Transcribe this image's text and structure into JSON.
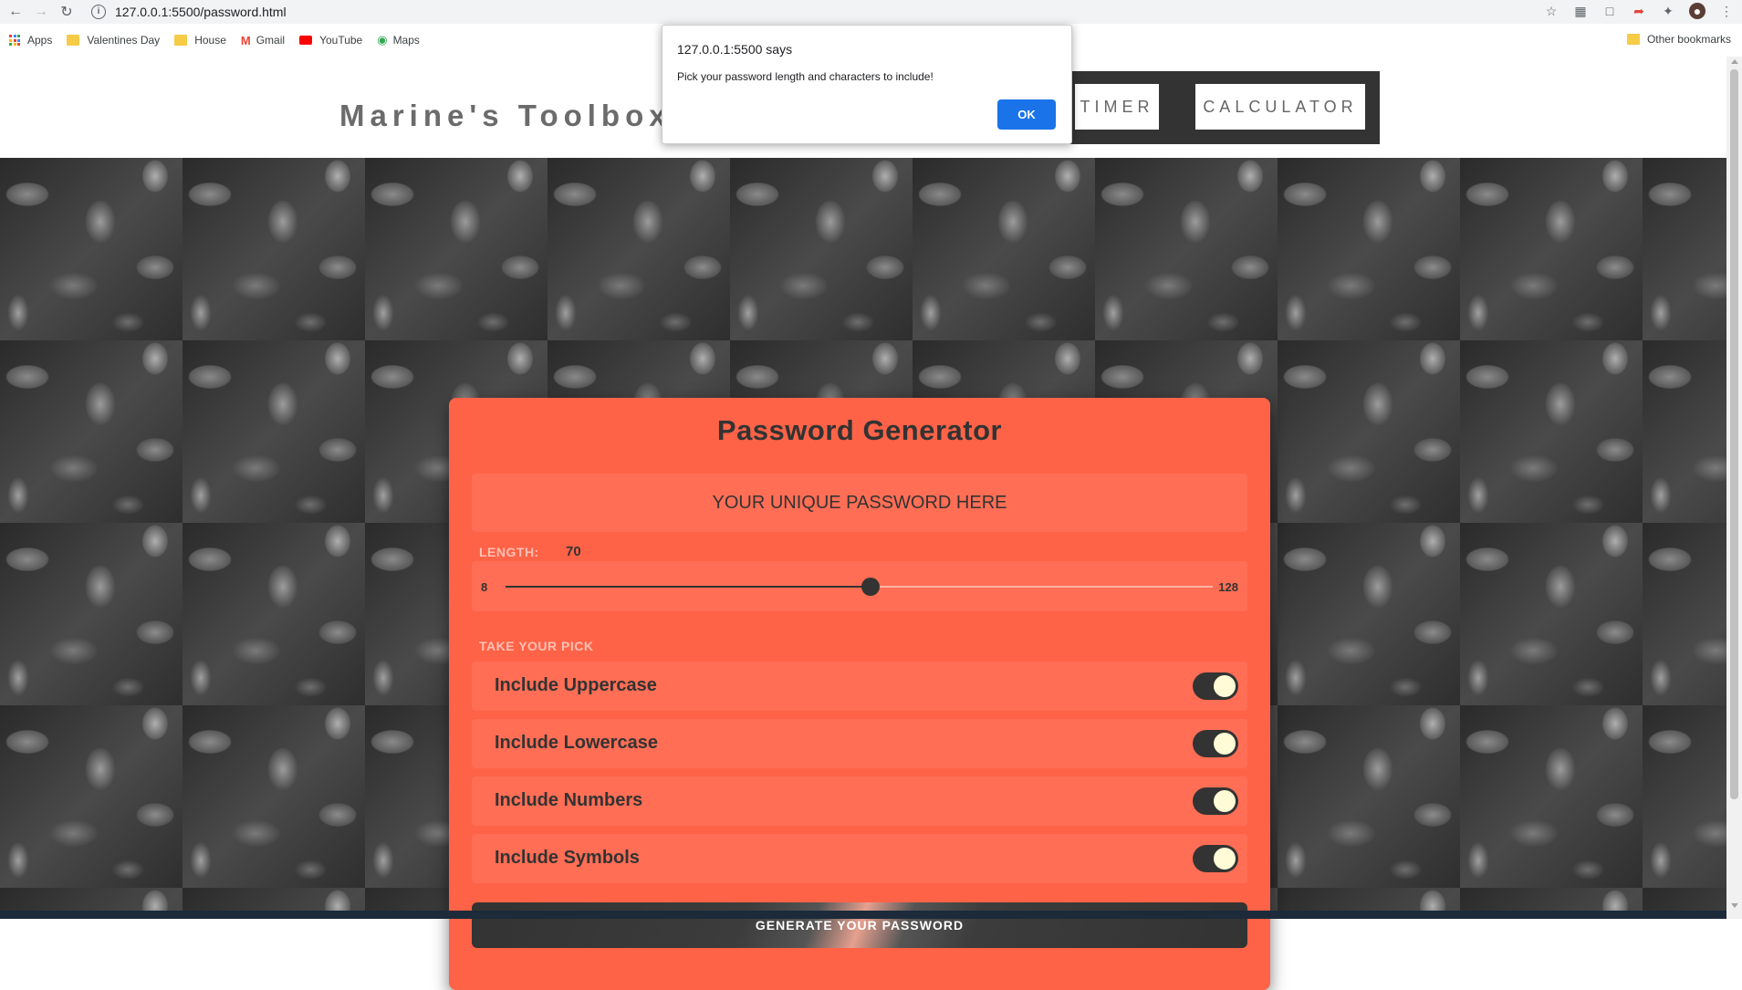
{
  "browser": {
    "url": "127.0.0.1:5500/password.html",
    "bookmarks": [
      "Apps",
      "Valentines Day",
      "House",
      "Gmail",
      "YouTube",
      "Maps"
    ],
    "other_bookmarks": "Other bookmarks"
  },
  "header": {
    "site_title": "Marine's Toolbox",
    "nav": [
      "TIMER",
      "CALCULATOR"
    ]
  },
  "alert": {
    "title": "127.0.0.1:5500 says",
    "message": "Pick your password length and characters to include!",
    "ok_label": "OK"
  },
  "generator": {
    "title": "Password Generator",
    "password_placeholder": "YOUR UNIQUE PASSWORD HERE",
    "length_label": "LENGTH:",
    "length_value": "70",
    "slider": {
      "min": "8",
      "max": "128",
      "value": 70
    },
    "pick_label": "TAKE YOUR PICK",
    "options": [
      {
        "label": "Include Uppercase",
        "checked": true
      },
      {
        "label": "Include Lowercase",
        "checked": true
      },
      {
        "label": "Include Numbers",
        "checked": true
      },
      {
        "label": "Include Symbols",
        "checked": true
      }
    ],
    "generate_label": "GENERATE YOUR PASSWORD"
  },
  "colors": {
    "card": "#ff6347",
    "card_row": "#ff6e55",
    "dark": "#333333",
    "toggle_knob": "#fffbd6",
    "alert_button": "#1a73e8"
  }
}
